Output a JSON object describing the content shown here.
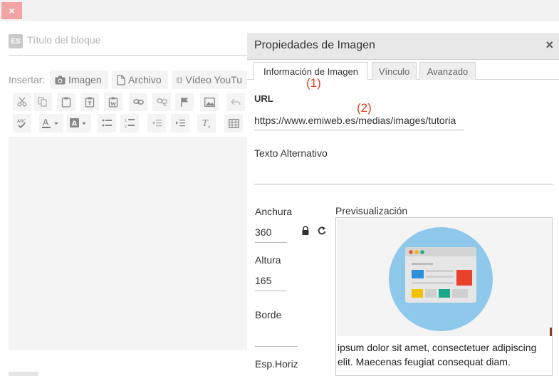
{
  "top_close": "×",
  "editor": {
    "lang_badge": "ES",
    "title_placeholder": "Título del bloque",
    "insert_label": "Insertar:",
    "insert_buttons": [
      {
        "label": "Imagen",
        "icon": "camera-icon"
      },
      {
        "label": "Archivo",
        "icon": "file-icon"
      },
      {
        "label": "Vídeo YouTu",
        "icon": "film-icon"
      }
    ]
  },
  "dialog": {
    "title": "Propiedades de Imagen",
    "close": "×",
    "tabs": [
      "Información de Imagen",
      "Vínculo",
      "Avanzado"
    ],
    "annotations": [
      "(1)",
      "(2)"
    ],
    "url_label": "URL",
    "url_value": "https://www.emiweb.es/medias/images/tutoria",
    "alt_label": "Texto Alternativo",
    "alt_value": "",
    "width_label": "Anchura",
    "width_value": "360",
    "height_label": "Altura",
    "height_value": "165",
    "border_label": "Borde",
    "border_value": "",
    "hspace_label": "Esp.Horiz",
    "preview_label": "Previsualización",
    "preview_text_1": "ipsum dolor sit amet, consectetuer adipiscing",
    "preview_text_2": "elit. Maecenas feugiat consequat diam."
  },
  "colors": {
    "accent_red": "#e03c1e",
    "close_pink": "#f2a3a3",
    "preview_circle": "#8ec9ec"
  }
}
